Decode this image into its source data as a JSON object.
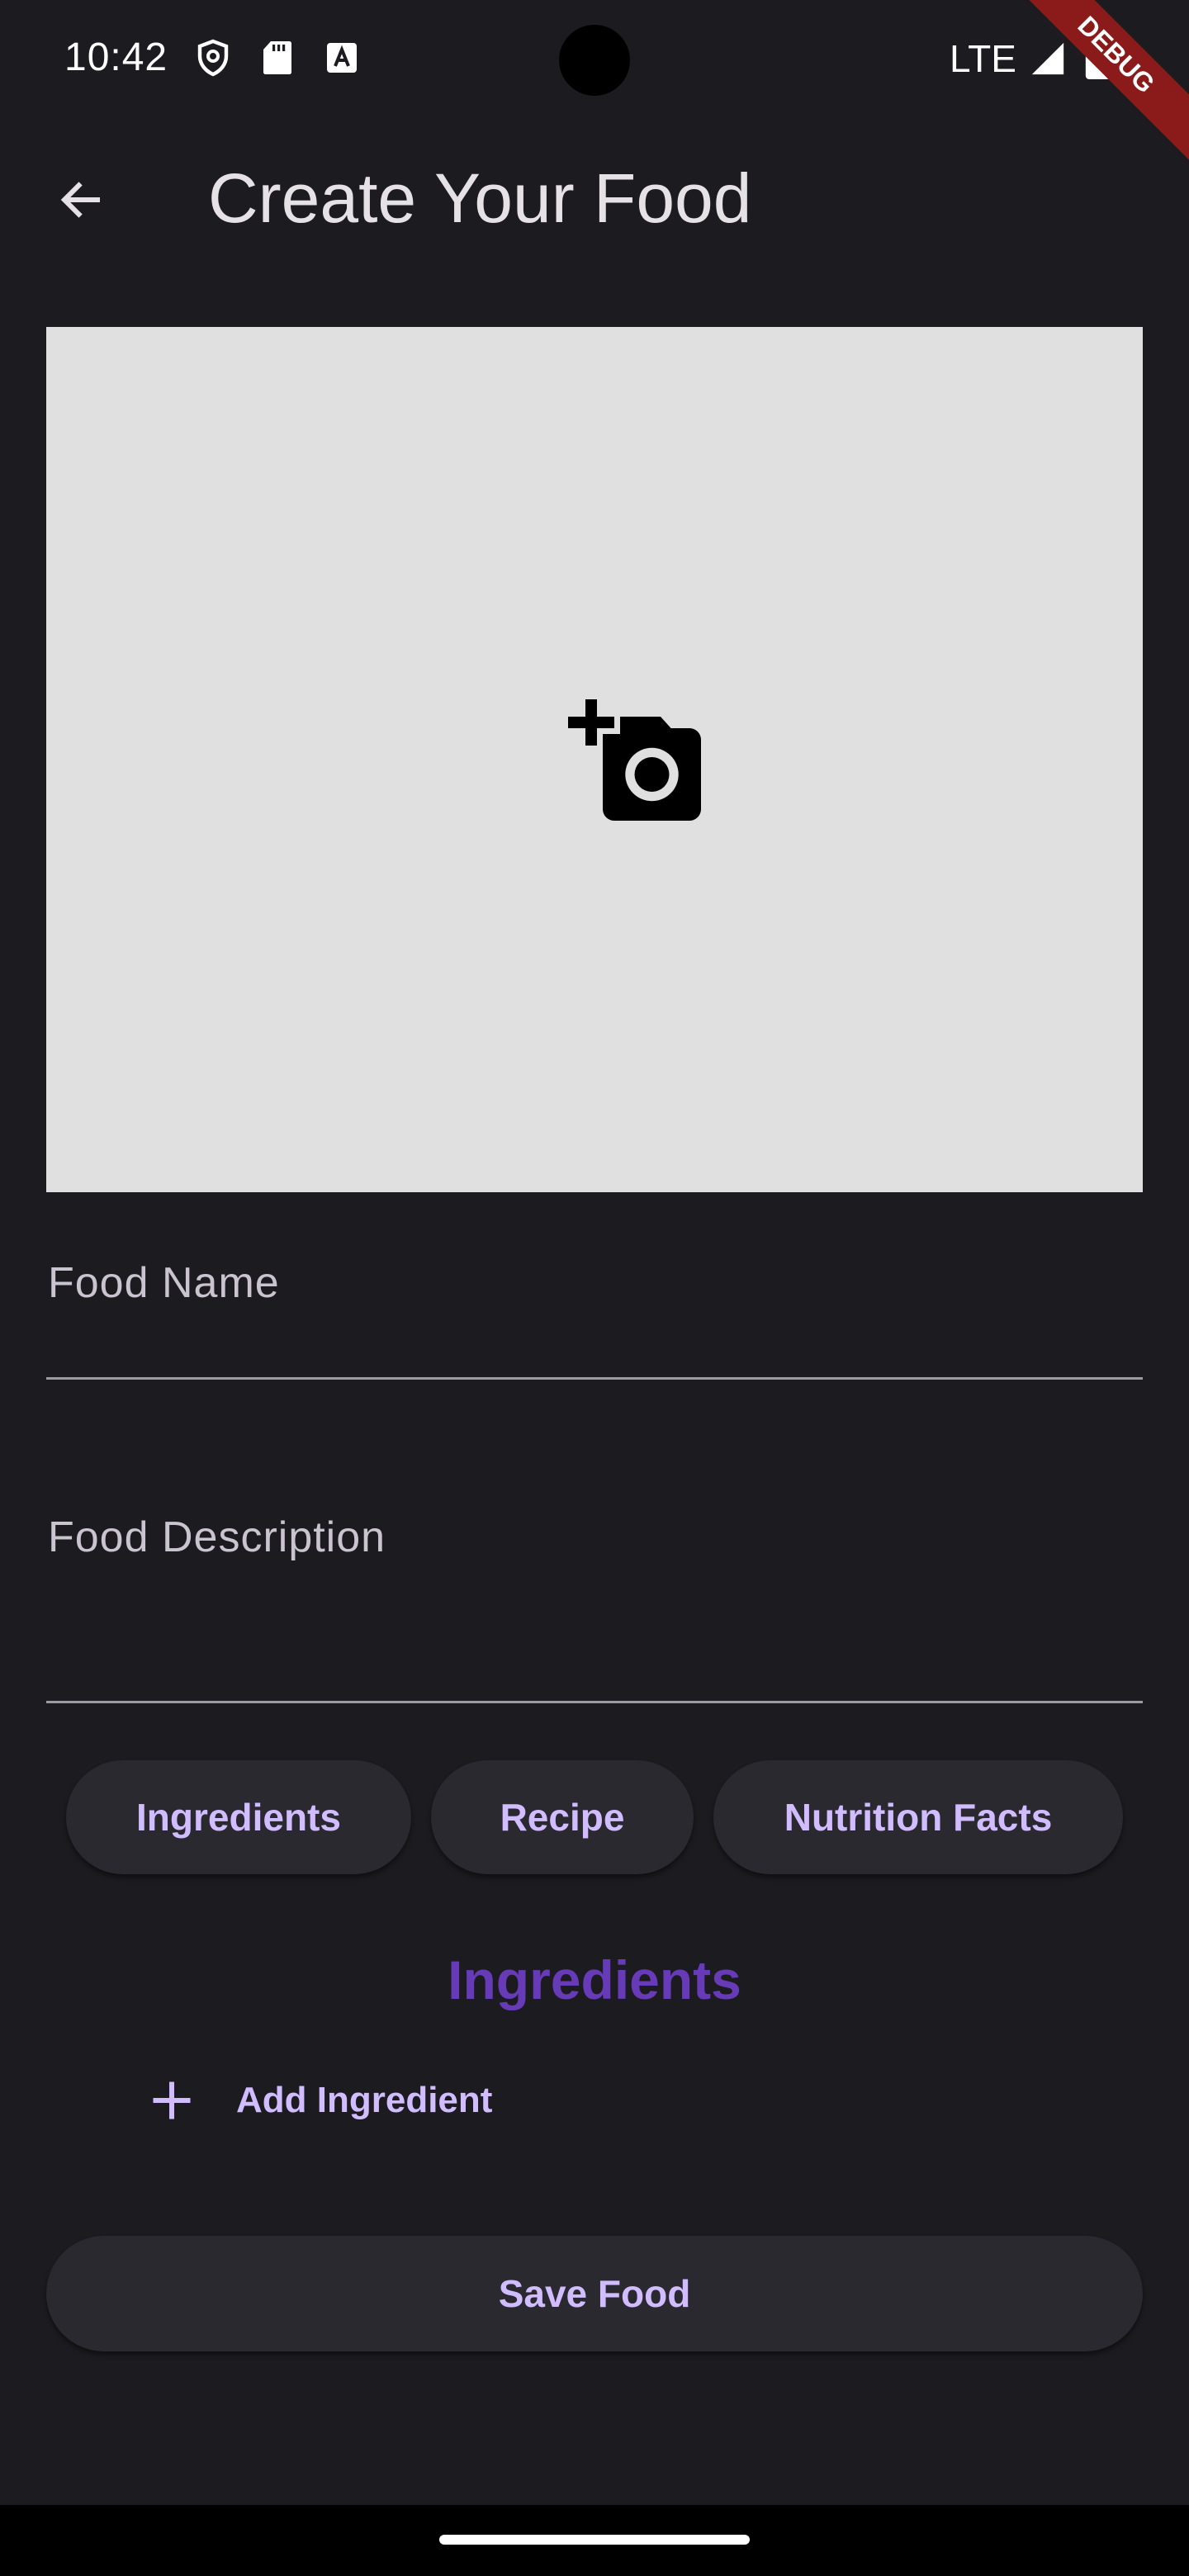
{
  "status_bar": {
    "time": "10:42",
    "network": "LTE",
    "debug_label": "DEBUG"
  },
  "app_bar": {
    "title": "Create Your Food",
    "back_icon": "arrow-back-icon"
  },
  "image_picker": {
    "icon": "add-a-photo-icon",
    "background": "#e0e0e0"
  },
  "form": {
    "food_name_label": "Food Name",
    "food_description_label": "Food Description"
  },
  "tabs": [
    {
      "label": "Ingredients"
    },
    {
      "label": "Recipe"
    },
    {
      "label": "Nutrition Facts"
    }
  ],
  "section": {
    "heading": "Ingredients",
    "add_label": "Add Ingredient",
    "add_icon": "plus-icon"
  },
  "actions": {
    "save_label": "Save Food"
  },
  "colors": {
    "background": "#1c1b1f",
    "accent": "#d0bcff",
    "heading": "#673ab7",
    "button_surface": "#2a2930"
  }
}
